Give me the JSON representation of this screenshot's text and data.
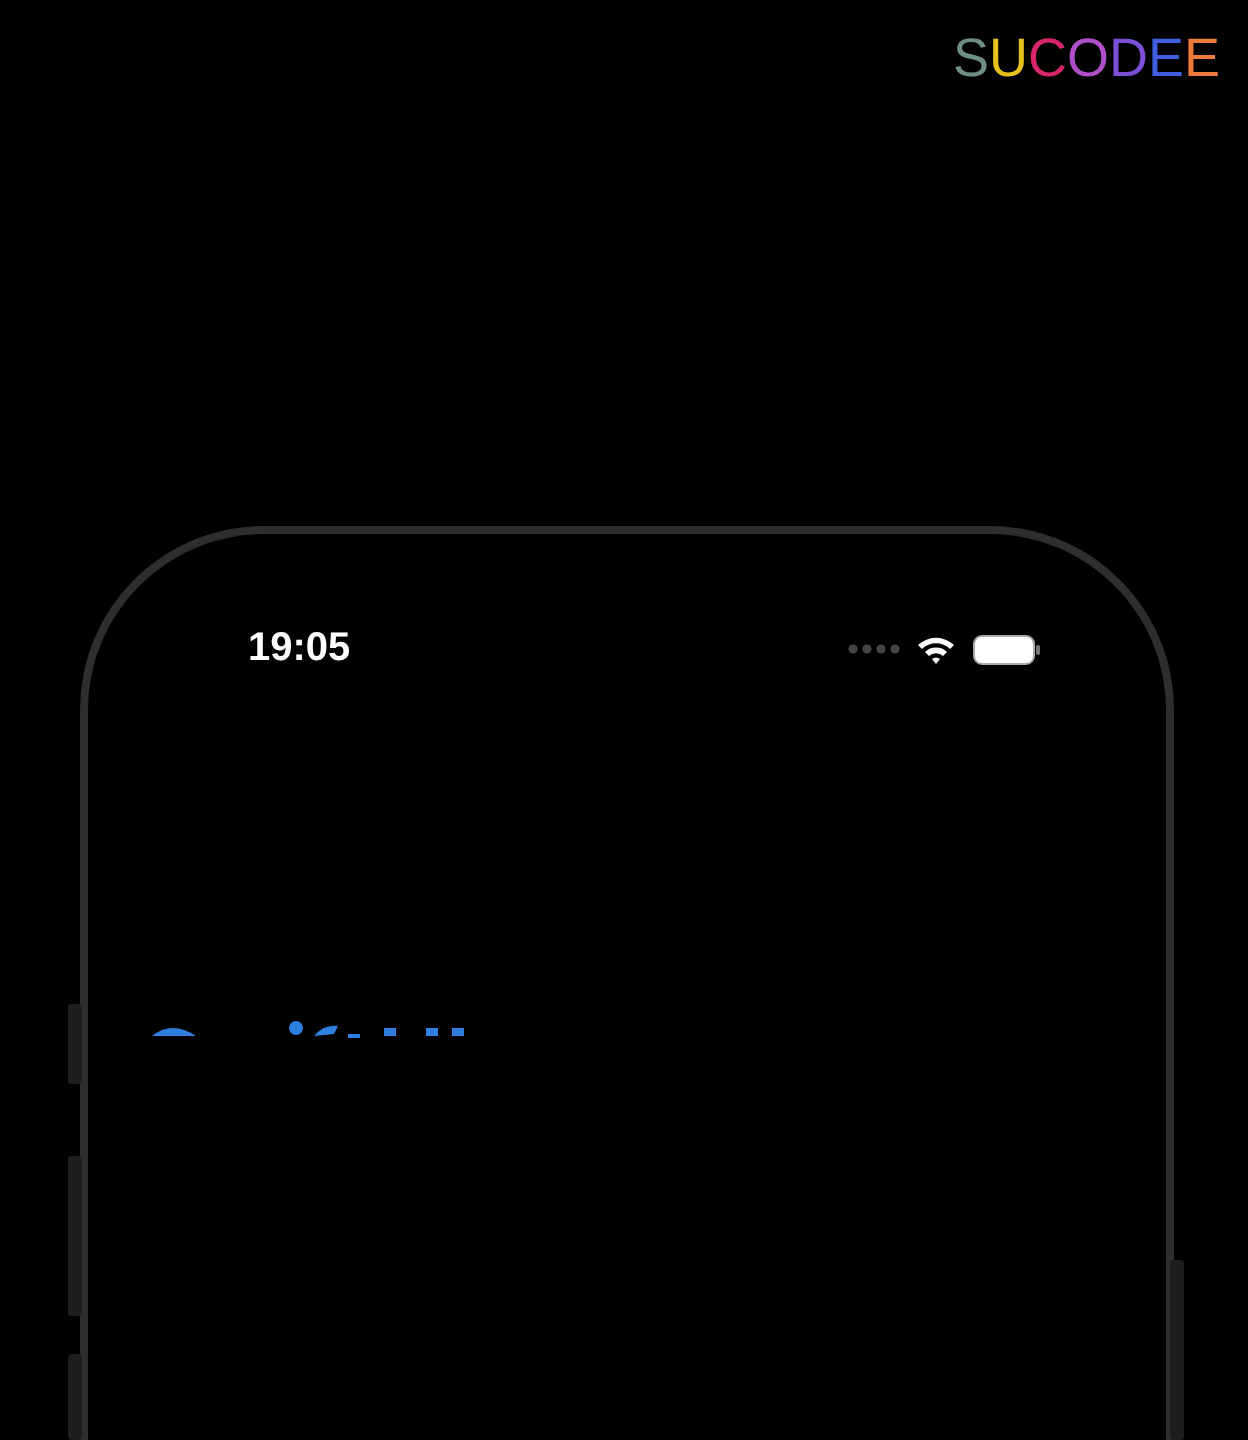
{
  "logo": {
    "text": "SUCODEE"
  },
  "phone": {
    "status_bar": {
      "time": "19:05"
    }
  }
}
